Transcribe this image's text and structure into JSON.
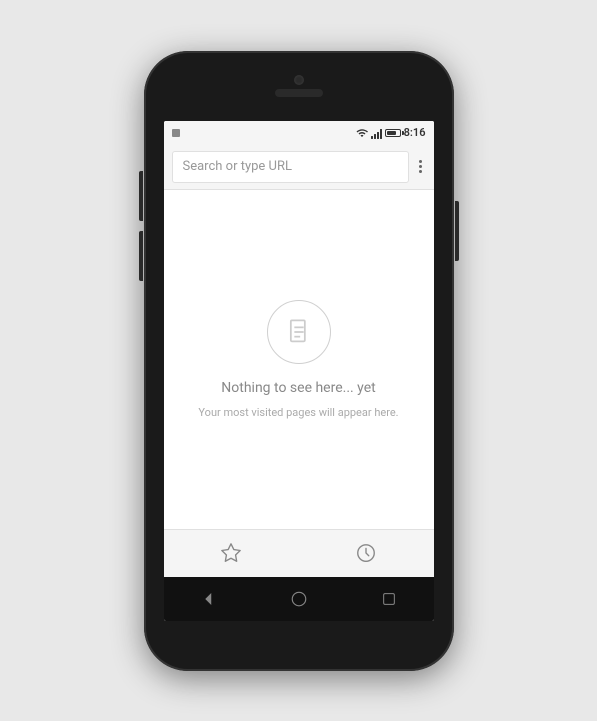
{
  "phone": {
    "status_bar": {
      "time": "8:16",
      "notification_icon": "notification"
    },
    "browser": {
      "url_placeholder": "Search or type URL",
      "menu_label": "⋮",
      "empty_state": {
        "title": "Nothing to see here... yet",
        "subtitle": "Your most visited pages will appear here."
      }
    },
    "nav_bar": {
      "back_label": "◁",
      "home_label": "○",
      "recents_label": "□"
    },
    "bottom_tabs": {
      "bookmarks_label": "bookmarks",
      "history_label": "history"
    }
  }
}
